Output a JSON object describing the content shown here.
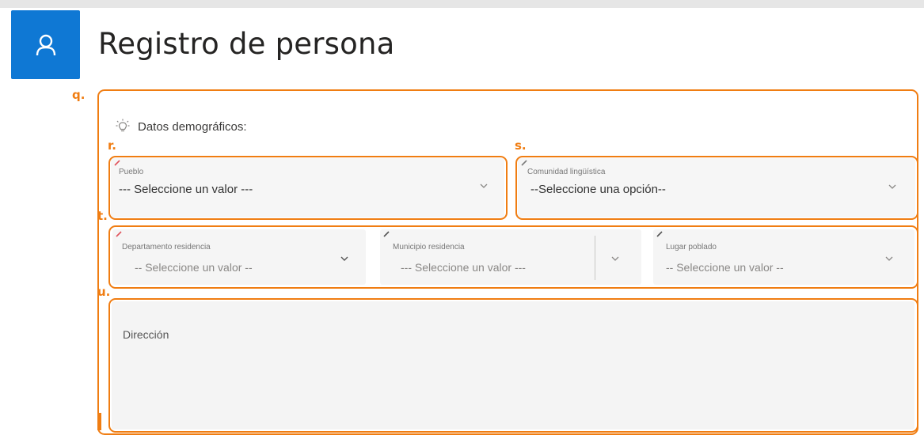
{
  "header": {
    "title": "Registro de persona",
    "avatar_icon": "person-icon",
    "accent": "#0f78d4"
  },
  "markers": {
    "q": "q.",
    "r": "r.",
    "s": "s.",
    "t": "t.",
    "u": "u."
  },
  "section": {
    "title": "Datos demográficos:",
    "icon": "lightbulb-icon"
  },
  "fields": {
    "pueblo": {
      "label": "Pueblo",
      "value": "--- Seleccione un valor ---"
    },
    "comunidad": {
      "label": "Comunidad lingüística",
      "value": "--Seleccione una opción--"
    },
    "departamento": {
      "label": "Departamento residencia",
      "value": "-- Seleccione un valor --"
    },
    "municipio": {
      "label": "Municipio residencia",
      "value": "--- Seleccione un valor ---"
    },
    "lugar": {
      "label": "Lugar poblado",
      "value": "-- Seleccione un valor --"
    },
    "direccion": {
      "placeholder": "Dirección"
    }
  },
  "annotation_color": "#f07d12"
}
